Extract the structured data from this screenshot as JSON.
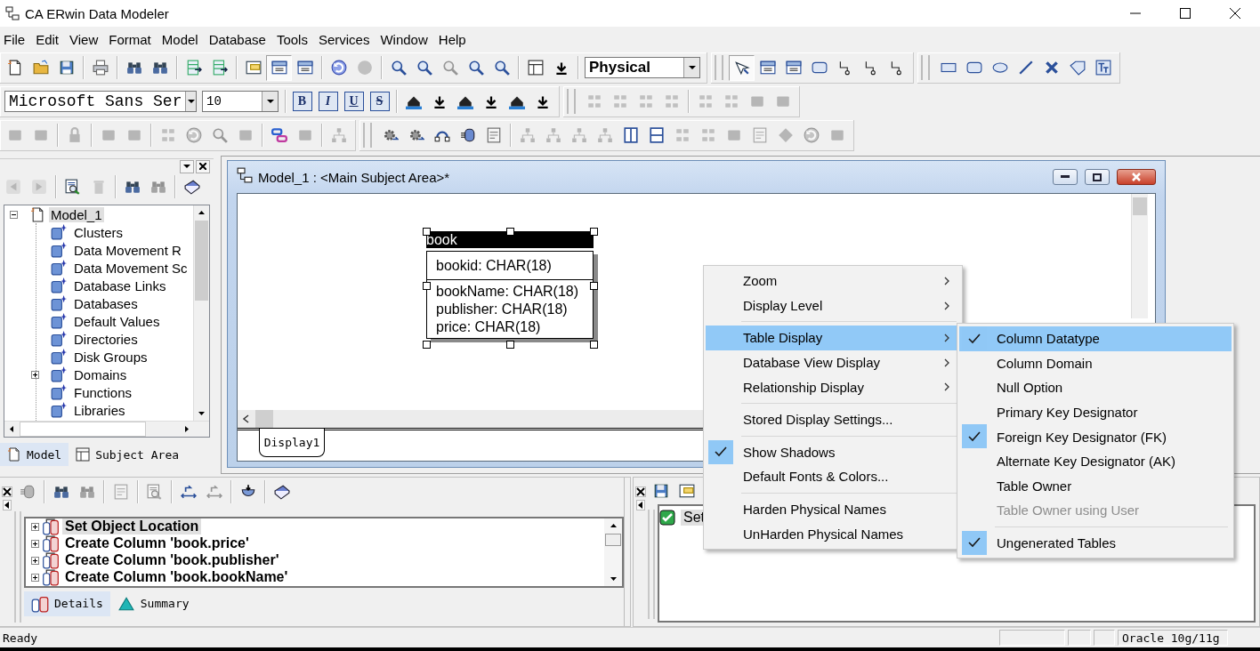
{
  "window": {
    "title": "CA ERwin Data Modeler"
  },
  "menu_bar": [
    "File",
    "Edit",
    "View",
    "Format",
    "Model",
    "Database",
    "Tools",
    "Services",
    "Window",
    "Help"
  ],
  "toolbar_rows": [
    [
      {
        "items": [
          {
            "kind": "page",
            "disabled": false,
            "pressed": false
          },
          {
            "kind": "folder",
            "disabled": false,
            "pressed": false
          },
          {
            "kind": "disk",
            "disabled": false,
            "pressed": false
          },
          {
            "kind": "separator"
          },
          {
            "kind": "printer",
            "disabled": false,
            "pressed": false
          },
          {
            "kind": "separator"
          },
          {
            "kind": "binoculars",
            "disabled": false,
            "pressed": false
          },
          {
            "kind": "binoculars",
            "disabled": false,
            "pressed": false
          },
          {
            "kind": "separator"
          },
          {
            "kind": "import",
            "disabled": false,
            "pressed": false
          },
          {
            "kind": "import",
            "disabled": false,
            "pressed": false
          },
          {
            "kind": "separator"
          },
          {
            "kind": "window",
            "disabled": false,
            "pressed": false
          },
          {
            "kind": "table",
            "disabled": false,
            "pressed": true
          },
          {
            "kind": "table",
            "disabled": false,
            "pressed": false
          },
          {
            "kind": "separator"
          },
          {
            "kind": "undo",
            "disabled": false,
            "pressed": false
          },
          {
            "kind": "circle",
            "disabled": true,
            "pressed": false
          },
          {
            "kind": "separator"
          },
          {
            "kind": "magnifier",
            "disabled": false,
            "pressed": false
          },
          {
            "kind": "magnifier",
            "disabled": false,
            "pressed": false
          },
          {
            "kind": "magnifier",
            "disabled": true,
            "pressed": false
          },
          {
            "kind": "magnifier",
            "disabled": false,
            "pressed": false
          },
          {
            "kind": "magnifier",
            "disabled": false,
            "pressed": false
          },
          {
            "kind": "separator"
          },
          {
            "kind": "layout",
            "disabled": false,
            "pressed": false
          },
          {
            "kind": "download",
            "disabled": false,
            "pressed": false
          },
          {
            "kind": "separator"
          },
          {
            "kind": "combo",
            "value": "Physical"
          }
        ]
      },
      {
        "items": [
          {
            "kind": "cursor",
            "disabled": false,
            "pressed": true
          },
          {
            "kind": "table",
            "disabled": false,
            "pressed": false
          },
          {
            "kind": "table",
            "disabled": false,
            "pressed": false
          },
          {
            "kind": "rounded",
            "disabled": false,
            "pressed": false
          },
          {
            "kind": "connector",
            "disabled": false,
            "pressed": false
          },
          {
            "kind": "connector",
            "disabled": false,
            "pressed": false
          },
          {
            "kind": "connector",
            "disabled": false,
            "pressed": false
          }
        ]
      },
      {
        "items": [
          {
            "kind": "rect",
            "disabled": false,
            "pressed": false
          },
          {
            "kind": "rounded",
            "disabled": false,
            "pressed": false
          },
          {
            "kind": "ellipse",
            "disabled": false,
            "pressed": false
          },
          {
            "kind": "line",
            "disabled": false,
            "pressed": false
          },
          {
            "kind": "cross",
            "disabled": false,
            "pressed": false
          },
          {
            "kind": "tag",
            "disabled": false,
            "pressed": false
          },
          {
            "kind": "textbox",
            "disabled": false,
            "pressed": false
          }
        ]
      }
    ],
    [
      {
        "items": [
          {
            "kind": "combo",
            "value": "Microsoft Sans Ser"
          },
          {
            "kind": "combo",
            "value": "10"
          },
          {
            "kind": "separator"
          },
          {
            "kind": "format",
            "label": "B",
            "disabled": false,
            "pressed": false
          },
          {
            "kind": "format",
            "label": "I",
            "disabled": false,
            "pressed": false
          },
          {
            "kind": "format",
            "label": "U",
            "disabled": false,
            "pressed": false
          },
          {
            "kind": "format",
            "label": "S",
            "disabled": false,
            "pressed": false
          },
          {
            "kind": "separator"
          },
          {
            "kind": "house",
            "disabled": false,
            "pressed": false
          },
          {
            "kind": "download",
            "disabled": false,
            "pressed": false
          },
          {
            "kind": "house",
            "disabled": false,
            "pressed": false
          },
          {
            "kind": "download",
            "disabled": false,
            "pressed": false
          },
          {
            "kind": "house",
            "disabled": false,
            "pressed": false
          },
          {
            "kind": "download",
            "disabled": false,
            "pressed": false
          }
        ]
      },
      {
        "items": [
          {
            "kind": "align",
            "disabled": true,
            "pressed": false
          },
          {
            "kind": "align",
            "disabled": true,
            "pressed": false
          },
          {
            "kind": "align",
            "disabled": true,
            "pressed": false
          },
          {
            "kind": "align",
            "disabled": true,
            "pressed": false
          },
          {
            "kind": "separator"
          },
          {
            "kind": "align",
            "disabled": true,
            "pressed": false
          },
          {
            "kind": "align",
            "disabled": true,
            "pressed": false
          },
          {
            "kind": "block",
            "disabled": true,
            "pressed": false
          },
          {
            "kind": "block",
            "disabled": true,
            "pressed": false
          }
        ]
      }
    ],
    [
      {
        "items": [
          {
            "kind": "block",
            "disabled": true,
            "pressed": false
          },
          {
            "kind": "block",
            "disabled": true,
            "pressed": false
          },
          {
            "kind": "separator"
          },
          {
            "kind": "lock",
            "disabled": true,
            "pressed": false
          },
          {
            "kind": "separator"
          },
          {
            "kind": "block",
            "disabled": true,
            "pressed": false
          },
          {
            "kind": "block",
            "disabled": true,
            "pressed": false
          },
          {
            "kind": "separator"
          },
          {
            "kind": "align",
            "disabled": true,
            "pressed": false
          },
          {
            "kind": "undo",
            "disabled": true,
            "pressed": false
          },
          {
            "kind": "magnifier",
            "disabled": true,
            "pressed": false
          },
          {
            "kind": "block",
            "disabled": true,
            "pressed": false
          },
          {
            "kind": "separator"
          },
          {
            "kind": "link",
            "disabled": false,
            "pressed": false
          },
          {
            "kind": "block",
            "disabled": true,
            "pressed": false
          },
          {
            "kind": "separator"
          },
          {
            "kind": "tree",
            "disabled": true,
            "pressed": false
          }
        ]
      },
      {
        "items": [
          {
            "kind": "gear",
            "disabled": false,
            "pressed": false
          },
          {
            "kind": "gear",
            "disabled": false,
            "pressed": false
          },
          {
            "kind": "arch",
            "disabled": false,
            "pressed": false
          },
          {
            "kind": "cylinder",
            "disabled": false,
            "pressed": false
          },
          {
            "kind": "note",
            "disabled": false,
            "pressed": false
          },
          {
            "kind": "separator"
          },
          {
            "kind": "tree",
            "disabled": true,
            "pressed": false
          },
          {
            "kind": "tree",
            "disabled": true,
            "pressed": false
          },
          {
            "kind": "tree",
            "disabled": true,
            "pressed": false
          },
          {
            "kind": "tree",
            "disabled": true,
            "pressed": false
          },
          {
            "kind": "columns",
            "disabled": false,
            "pressed": false
          },
          {
            "kind": "rows",
            "disabled": false,
            "pressed": false
          },
          {
            "kind": "align",
            "disabled": true,
            "pressed": false
          },
          {
            "kind": "align",
            "disabled": true,
            "pressed": false
          },
          {
            "kind": "block",
            "disabled": true,
            "pressed": false
          },
          {
            "kind": "note",
            "disabled": true,
            "pressed": false
          },
          {
            "kind": "diamond",
            "disabled": true,
            "pressed": false
          },
          {
            "kind": "undo",
            "disabled": true,
            "pressed": false
          },
          {
            "kind": "block",
            "disabled": true,
            "pressed": false
          }
        ]
      }
    ]
  ],
  "model_explorer": {
    "toolbar": {
      "items": [
        {
          "kind": "back",
          "disabled": true,
          "pressed": false
        },
        {
          "kind": "forward",
          "disabled": true,
          "pressed": false
        },
        {
          "kind": "separator"
        },
        {
          "kind": "docsearch",
          "disabled": false,
          "pressed": false
        },
        {
          "kind": "trash",
          "disabled": true,
          "pressed": false
        },
        {
          "kind": "separator"
        },
        {
          "kind": "binoculars",
          "disabled": false,
          "pressed": false
        },
        {
          "kind": "binoculars",
          "disabled": true,
          "pressed": false
        },
        {
          "kind": "separator"
        },
        {
          "kind": "book",
          "disabled": false,
          "pressed": false
        }
      ]
    },
    "tree": {
      "label": "Model_1",
      "expanded": true,
      "selected": true,
      "children": [
        {
          "label": "Clusters",
          "kind": "leaf",
          "selected": false
        },
        {
          "label": "Data Movement R",
          "kind": "leaf",
          "selected": false
        },
        {
          "label": "Data Movement Sc",
          "kind": "leaf",
          "selected": false
        },
        {
          "label": "Database Links",
          "kind": "leaf",
          "selected": false
        },
        {
          "label": "Databases",
          "kind": "leaf",
          "selected": false
        },
        {
          "label": "Default Values",
          "kind": "leaf",
          "selected": false
        },
        {
          "label": "Directories",
          "kind": "leaf",
          "selected": false
        },
        {
          "label": "Disk Groups",
          "kind": "leaf",
          "selected": false
        },
        {
          "label": "Domains",
          "kind": "group",
          "selected": false
        },
        {
          "label": "Functions",
          "kind": "leaf",
          "selected": false
        },
        {
          "label": "Libraries",
          "kind": "leaf",
          "selected": false
        }
      ]
    },
    "tabs": [
      {
        "label": "Model",
        "selected": true
      },
      {
        "label": "Subject Area",
        "selected": false
      }
    ]
  },
  "document_window": {
    "title": "Model_1 : <Main Subject Area>*",
    "entities": [
      {
        "name": "book",
        "selected": true,
        "shadow": true,
        "key_columns": [
          "bookid: CHAR(18)"
        ],
        "columns": [
          "bookName: CHAR(18)",
          "publisher: CHAR(18)",
          "price: CHAR(18)"
        ]
      }
    ],
    "tabs": [
      {
        "label": "Display1",
        "selected": true
      }
    ]
  },
  "action_log": {
    "toolbar": {
      "items": [
        {
          "kind": "cylinder",
          "disabled": true,
          "pressed": false
        },
        {
          "kind": "separator"
        },
        {
          "kind": "binoculars",
          "disabled": false,
          "pressed": false
        },
        {
          "kind": "binoculars",
          "disabled": true,
          "pressed": false
        },
        {
          "kind": "separator"
        },
        {
          "kind": "note",
          "disabled": true,
          "pressed": false
        },
        {
          "kind": "separator"
        },
        {
          "kind": "docsearch",
          "disabled": true,
          "pressed": false
        },
        {
          "kind": "separator"
        },
        {
          "kind": "swap",
          "disabled": false,
          "pressed": false
        },
        {
          "kind": "swap",
          "disabled": true,
          "pressed": false
        },
        {
          "kind": "separator"
        },
        {
          "kind": "stamp",
          "disabled": false,
          "pressed": false
        },
        {
          "kind": "separator"
        },
        {
          "kind": "book",
          "disabled": false,
          "pressed": false
        }
      ]
    },
    "entries": [
      {
        "label": "Set Object Location",
        "selected": true
      },
      {
        "label": "Create Column 'book.price'",
        "selected": false
      },
      {
        "label": "Create Column 'book.publisher'",
        "selected": false
      },
      {
        "label": "Create Column 'book.bookName'",
        "selected": false
      }
    ],
    "tabs": [
      {
        "label": "Details",
        "selected": true
      },
      {
        "label": "Summary",
        "selected": false
      }
    ]
  },
  "validation_panel": {
    "toolbar": {
      "items": [
        {
          "kind": "disk",
          "disabled": false,
          "pressed": false
        },
        {
          "kind": "window",
          "disabled": false,
          "pressed": false
        }
      ]
    },
    "entries": [
      {
        "label": "Set",
        "checked": true,
        "selected": true
      }
    ]
  },
  "context_menu": {
    "items": [
      {
        "kind": "item",
        "label": "Zoom",
        "submenu": true,
        "checked": false,
        "selected": false
      },
      {
        "kind": "item",
        "label": "Display Level",
        "submenu": true,
        "checked": false,
        "selected": false
      },
      {
        "kind": "separator"
      },
      {
        "kind": "item",
        "label": "Table Display",
        "submenu": true,
        "checked": false,
        "selected": true
      },
      {
        "kind": "item",
        "label": "Database View Display",
        "submenu": true,
        "checked": false,
        "selected": false
      },
      {
        "kind": "item",
        "label": "Relationship Display",
        "submenu": true,
        "checked": false,
        "selected": false
      },
      {
        "kind": "separator"
      },
      {
        "kind": "item",
        "label": "Stored Display Settings...",
        "submenu": false,
        "checked": false,
        "selected": false
      },
      {
        "kind": "separator"
      },
      {
        "kind": "item",
        "label": "Show Shadows",
        "submenu": false,
        "checked": true,
        "selected": false
      },
      {
        "kind": "item",
        "label": "Default Fonts & Colors...",
        "submenu": false,
        "checked": false,
        "selected": false
      },
      {
        "kind": "separator"
      },
      {
        "kind": "item",
        "label": "Harden Physical Names",
        "submenu": false,
        "checked": false,
        "selected": false
      },
      {
        "kind": "item",
        "label": "UnHarden Physical Names",
        "submenu": false,
        "checked": false,
        "selected": false
      }
    ]
  },
  "submenu": {
    "items": [
      {
        "kind": "item",
        "label": "Column Datatype",
        "checked": true,
        "selected": true,
        "disabled": false
      },
      {
        "kind": "item",
        "label": "Column Domain",
        "checked": false,
        "selected": false,
        "disabled": false
      },
      {
        "kind": "item",
        "label": "Null Option",
        "checked": false,
        "selected": false,
        "disabled": false
      },
      {
        "kind": "item",
        "label": "Primary Key Designator",
        "checked": false,
        "selected": false,
        "disabled": false
      },
      {
        "kind": "item",
        "label": "Foreign Key Designator (FK)",
        "checked": true,
        "selected": false,
        "disabled": false
      },
      {
        "kind": "item",
        "label": "Alternate Key Designator (AK)",
        "checked": false,
        "selected": false,
        "disabled": false
      },
      {
        "kind": "item",
        "label": "Table Owner",
        "checked": false,
        "selected": false,
        "disabled": false
      },
      {
        "kind": "item",
        "label": "Table Owner using User",
        "checked": false,
        "selected": false,
        "disabled": true
      },
      {
        "kind": "separator"
      },
      {
        "kind": "item",
        "label": "Ungenerated Tables",
        "checked": true,
        "selected": false,
        "disabled": false
      }
    ]
  },
  "status_bar": {
    "message": "Ready",
    "database": "Oracle 10g/11g"
  }
}
